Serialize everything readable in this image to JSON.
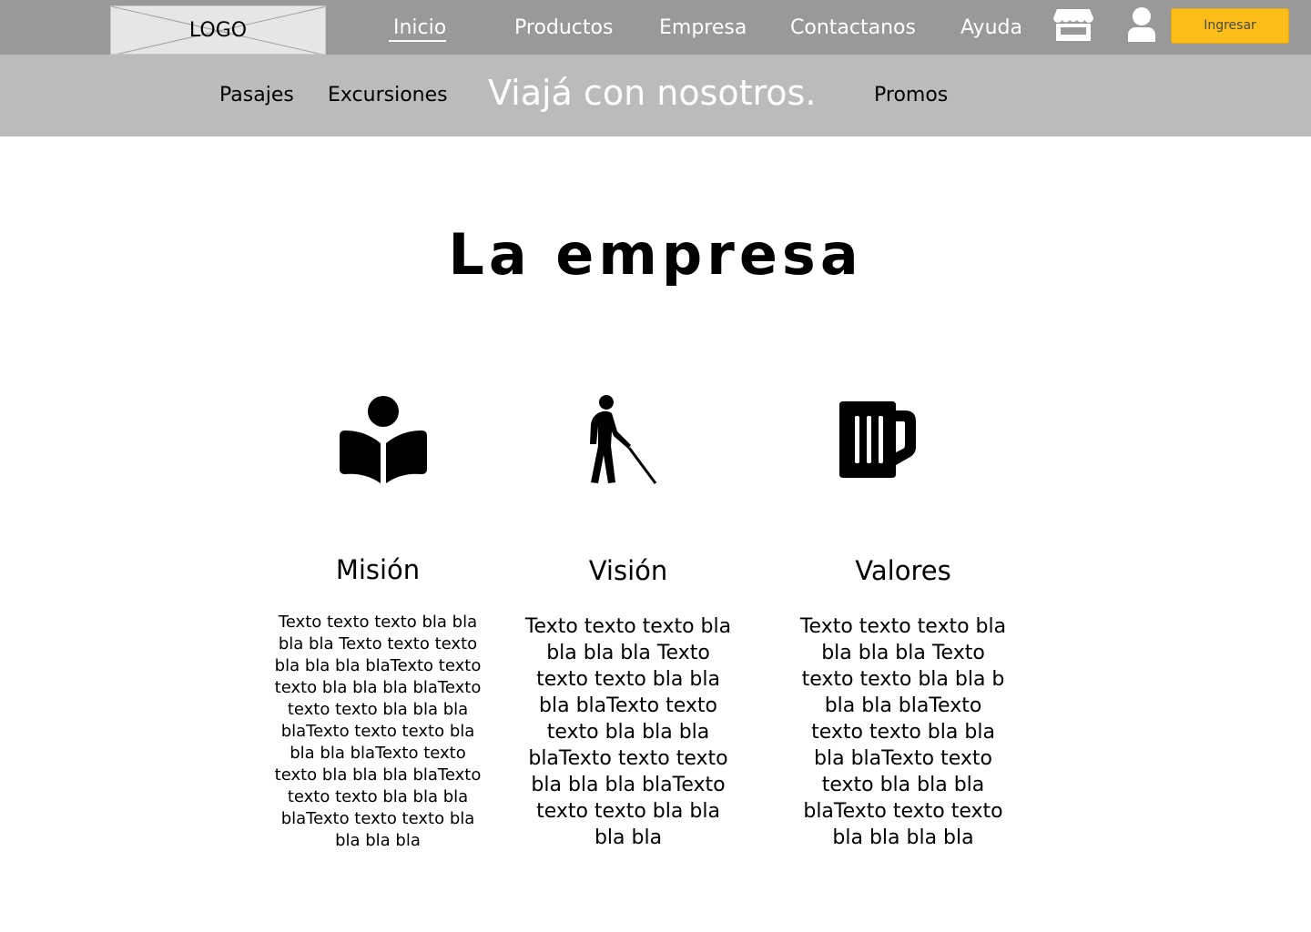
{
  "header": {
    "logo_text": "LOGO",
    "nav": [
      "Inicio",
      "Productos",
      "Empresa",
      "Contactanos",
      "Ayuda"
    ],
    "active_nav": "Inicio",
    "icons": [
      "store-icon",
      "user-icon"
    ],
    "login_label": "Ingresar",
    "accent_color": "#fbbd17"
  },
  "subnav": {
    "left": [
      "Pasajes",
      "Excursiones"
    ],
    "slogan": "Viajá con nosotros.",
    "right": [
      "Promos"
    ]
  },
  "main": {
    "title": "La empresa",
    "columns": [
      {
        "icon": "book-reader-icon",
        "title": "Misión",
        "lines": [
          "Texto texto texto bla bla",
          "bla bla Texto texto texto",
          "bla bla bla blaTexto texto",
          "texto bla bla bla blaTexto",
          "texto texto bla bla bla",
          "blaTexto texto texto bla",
          "bla bla blaTexto texto",
          "texto bla bla bla blaTexto",
          "texto texto bla bla bla",
          "blaTexto texto texto bla",
          "bla bla bla"
        ]
      },
      {
        "icon": "blind-person-cane-icon",
        "title": "Visión",
        "lines": [
          "Texto texto texto bla",
          "bla bla bla Texto",
          "texto texto bla bla",
          "bla blaTexto texto",
          "texto bla bla bla",
          "blaTexto texto texto",
          "bla bla bla blaTexto",
          "texto texto bla bla",
          "bla bla"
        ]
      },
      {
        "icon": "beer-mug-icon",
        "title": "Valores",
        "lines": [
          "Texto texto texto bla",
          "bla bla bla Texto",
          "texto texto bla bla b",
          "bla bla blaTexto",
          "texto texto bla bla",
          "bla blaTexto texto",
          "texto bla bla bla",
          "blaTexto texto texto",
          "bla bla bla bla"
        ]
      }
    ]
  }
}
